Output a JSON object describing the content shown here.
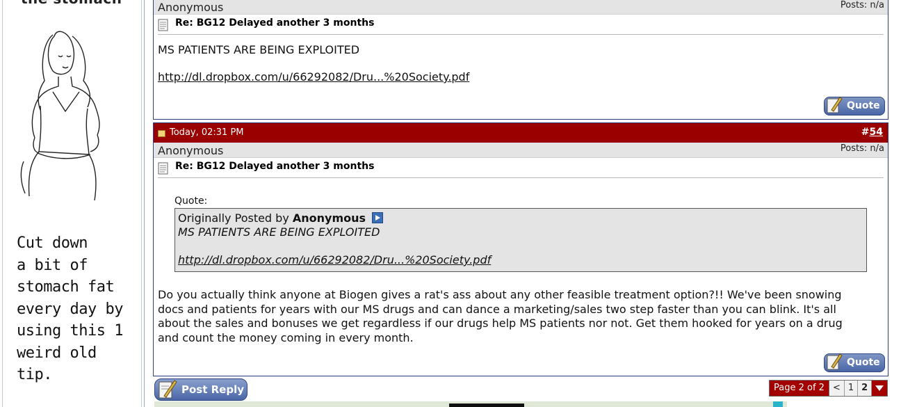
{
  "ad": {
    "top_text": "the stomach",
    "copy_lines": [
      "Cut down",
      "a bit of",
      "stomach fat",
      "every day by",
      "using this 1",
      "weird old",
      "tip."
    ]
  },
  "post1": {
    "username": "Anonymous",
    "posts": "Posts: n/a",
    "title": "Re: BG12 Delayed another 3 months",
    "body_line": "MS PATIENTS ARE BEING EXPLOITED",
    "link": "http://dl.dropbox.com/u/66292082/Dru...%20Society.pdf",
    "quote_label": "Quote"
  },
  "post2": {
    "date": "Today, 02:31 PM",
    "post_number_prefix": "#",
    "post_number": "54",
    "username": "Anonymous",
    "posts": "Posts: n/a",
    "title": "Re: BG12 Delayed another 3 months",
    "quote_heading": "Quote:",
    "quote_originally": "Originally Posted by",
    "quote_author": "Anonymous",
    "quote_line1": "MS PATIENTS ARE BEING EXPLOITED",
    "quote_link": "http://dl.dropbox.com/u/66292082/Dru...%20Society.pdf",
    "body_lines": [
      "Do you actually think anyone at Biogen gives a rat's ass about any other feasible treatment option?!! We've been snowing",
      "docs and patients for years with our MS drugs and can dance a marketing/sales two step faster than you can blink. It's all",
      "about the sales and bonuses we get regardless if our drugs help MS patients nor not. Get them hooked for years on a drug",
      "and count the money coming in every month."
    ],
    "quote_label": "Quote"
  },
  "controls": {
    "post_reply": "Post Reply",
    "page_info": "Page 2 of 2",
    "prev": "<",
    "page1": "1",
    "page2": "2"
  },
  "colors": {
    "header_red": "#9a0000",
    "border_blue": "#2b3f7c",
    "user_bar_gray": "#e4e4e4",
    "button_blue": "#4a66a7"
  }
}
